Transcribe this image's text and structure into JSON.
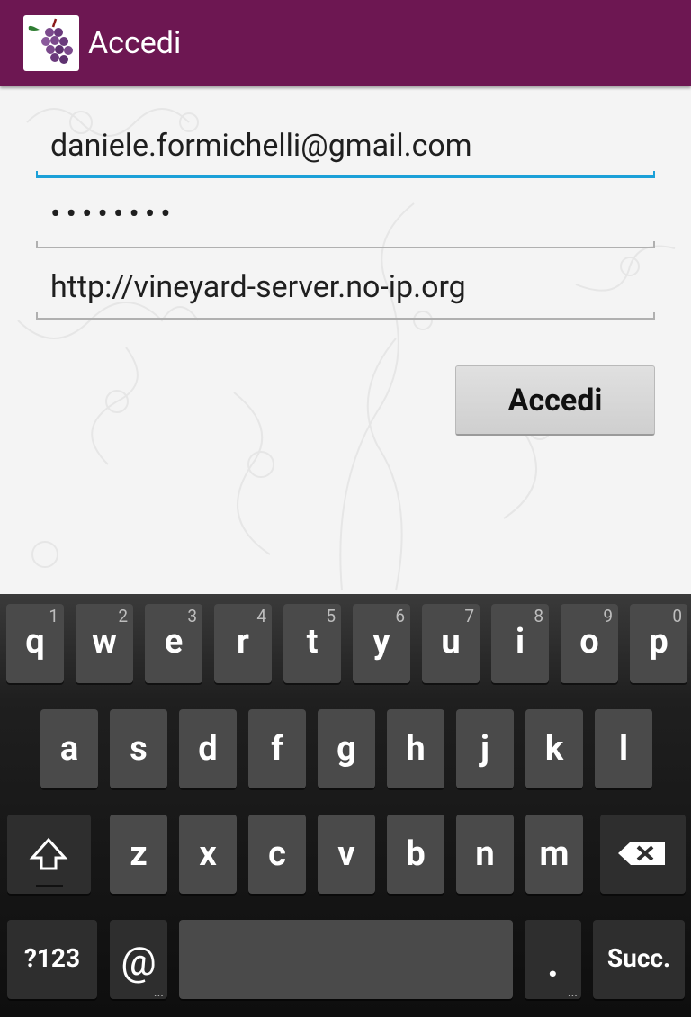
{
  "action_bar": {
    "title": "Accedi",
    "logo": "grape-logo-icon",
    "color": "#6d1752"
  },
  "form": {
    "email": {
      "value": "daniele.formichelli@gmail.com",
      "focused": true
    },
    "password": {
      "value": "••••••••"
    },
    "server_url": {
      "value": "http://vineyard-server.no-ip.org"
    },
    "submit_label": "Accedi"
  },
  "keyboard": {
    "row1": [
      {
        "k": "q",
        "n": "1"
      },
      {
        "k": "w",
        "n": "2"
      },
      {
        "k": "e",
        "n": "3"
      },
      {
        "k": "r",
        "n": "4"
      },
      {
        "k": "t",
        "n": "5"
      },
      {
        "k": "y",
        "n": "6"
      },
      {
        "k": "u",
        "n": "7"
      },
      {
        "k": "i",
        "n": "8"
      },
      {
        "k": "o",
        "n": "9"
      },
      {
        "k": "p",
        "n": "0"
      }
    ],
    "row2": [
      "a",
      "s",
      "d",
      "f",
      "g",
      "h",
      "j",
      "k",
      "l"
    ],
    "row3": [
      "z",
      "x",
      "c",
      "v",
      "b",
      "n",
      "m"
    ],
    "symbols_label": "?123",
    "at_label": "@",
    "period_label": ".",
    "enter_label": "Succ.",
    "shift_icon": "shift-icon",
    "backspace_icon": "backspace-icon"
  },
  "colors": {
    "focus_accent": "#1ba0d8",
    "key_background": "#4a4a4a"
  }
}
